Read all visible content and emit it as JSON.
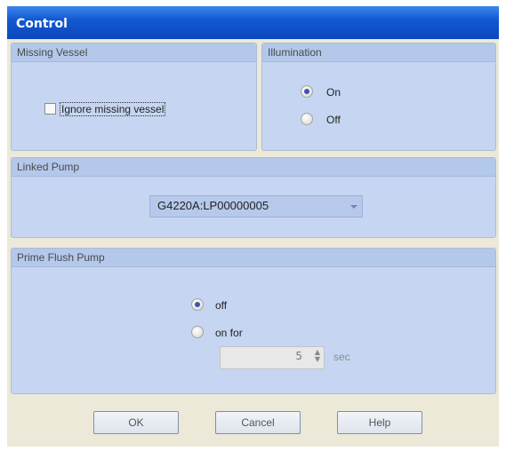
{
  "window": {
    "title": "Control"
  },
  "missing_vessel": {
    "heading": "Missing Vessel",
    "ignore_label": "Ignore missing vessel",
    "ignore_checked": false
  },
  "illumination": {
    "heading": "Illumination",
    "on_label": "On",
    "off_label": "Off",
    "selected": "On"
  },
  "linked_pump": {
    "heading": "Linked Pump",
    "selected": "G4220A:LP00000005"
  },
  "prime_flush": {
    "heading": "Prime Flush Pump",
    "off_label": "off",
    "on_label": "on for",
    "selected": "off",
    "seconds": "5",
    "unit": "sec"
  },
  "buttons": {
    "ok": "OK",
    "cancel": "Cancel",
    "help": "Help"
  },
  "colors": {
    "titlebar": "#0b47bd",
    "panel": "#c6d6f2",
    "panel_header": "#b3c8ea"
  }
}
